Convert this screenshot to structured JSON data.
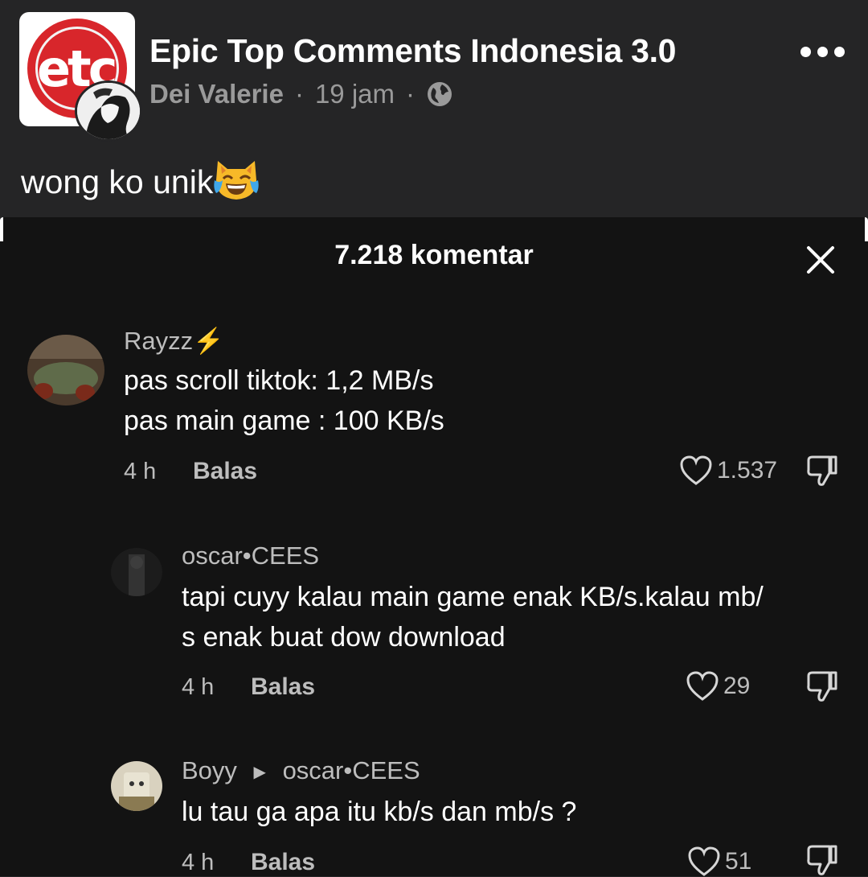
{
  "post": {
    "group_name": "Epic Top Comments Indonesia 3.0",
    "logo_text": "etc",
    "author": "Dei Valerie",
    "separator": "·",
    "time": "19 jam",
    "caption": "wong ko unik",
    "caption_emoji": "cat-tears-of-joy"
  },
  "sheet": {
    "title": "7.218 komentar",
    "comments": [
      {
        "user": "Rayzz⚡",
        "lines": [
          "pas scroll tiktok: 1,2 MB/s",
          "pas main game : 100 KB/s"
        ],
        "time": "4 h",
        "reply_label": "Balas",
        "likes": "1.537"
      },
      {
        "user": "oscar•CEES",
        "lines": [
          "tapi cuyy kalau main game enak KB/s.kalau mb/",
          "s enak buat dow download"
        ],
        "time": "4 h",
        "reply_label": "Balas",
        "likes": "29"
      },
      {
        "user": "Boyy",
        "reply_to": "oscar•CEES",
        "lines": [
          "lu tau ga apa itu kb/s dan mb/s ?"
        ],
        "time": "4 h",
        "reply_label": "Balas",
        "likes": "51"
      }
    ]
  },
  "colors": {
    "post_bg": "#252526",
    "sheet_bg": "#131313",
    "logo_red": "#d8262b",
    "muted_text": "#bdbdbd"
  }
}
